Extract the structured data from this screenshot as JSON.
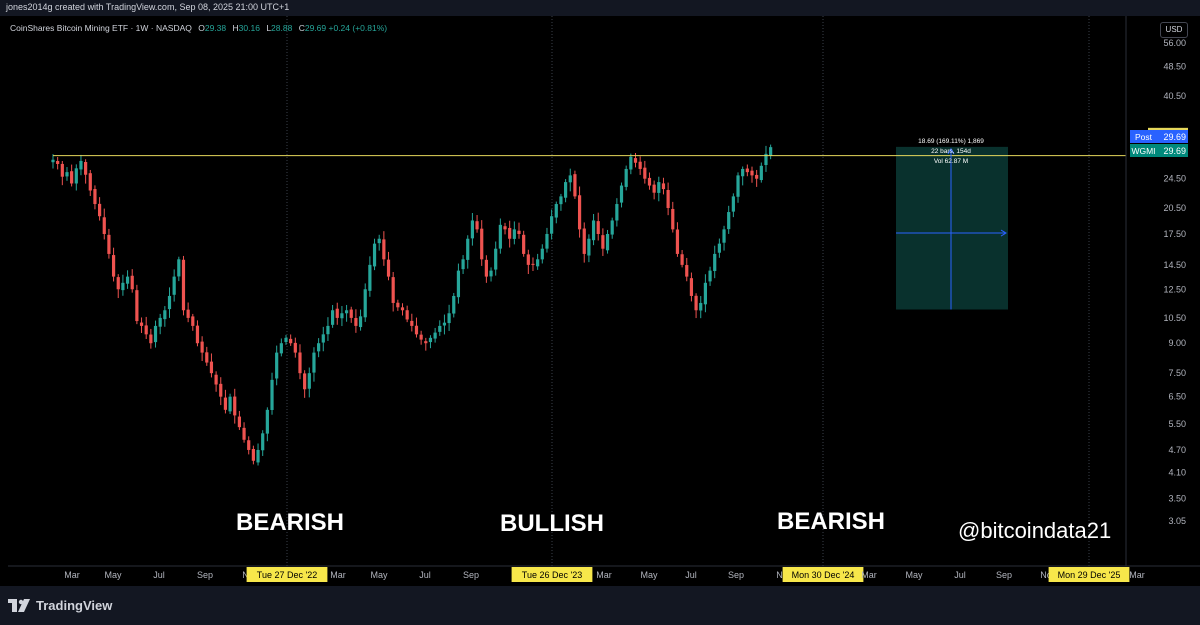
{
  "header": {
    "created_by": "jones2014g created with TradingView.com, Sep 08, 2025 21:00 UTC+1"
  },
  "legend": {
    "symbol": "CoinShares Bitcoin Mining ETF · 1W · NASDAQ",
    "open_label": "O",
    "open": "29.38",
    "high_label": "H",
    "high": "30.16",
    "low_label": "L",
    "low": "28.88",
    "close_label": "C",
    "close": "29.69",
    "change": "+0.24 (+0.81%)"
  },
  "currency": "USD",
  "footer": {
    "brand": "TradingView"
  },
  "colors": {
    "up": "#26a69a",
    "down": "#ef5350",
    "level": "#e6d85c",
    "measure": "#2962ff",
    "measure_fill": "#0b3a35",
    "post": "#2962ff",
    "ticker": "#00897b",
    "date_tag": "#f7e74a"
  },
  "chart_data": {
    "type": "candlestick",
    "symbol": "WGMI",
    "interval": "1W",
    "y_scale": "log",
    "ylim": [
      2.7,
      57
    ],
    "y_ticks": [
      3.05,
      3.5,
      4.1,
      4.7,
      5.5,
      6.5,
      7.5,
      9.0,
      10.5,
      12.5,
      14.5,
      17.5,
      20.5,
      24.5,
      28.5,
      40.5,
      48.5,
      56.0
    ],
    "y_tick_labels": [
      "3.05",
      "3.50",
      "4.10",
      "4.70",
      "5.50",
      "6.50",
      "7.50",
      "9.00",
      "10.50",
      "12.50",
      "14.50",
      "17.50",
      "20.50",
      "24.50",
      "28.50",
      "40.50",
      "48.50",
      "56.00"
    ],
    "x_labels": [
      "Mar",
      "May",
      "Jul",
      "Sep",
      "Nov",
      "Tue 27 Dec '22",
      "Mar",
      "May",
      "Jul",
      "Sep",
      "Nov",
      "Tue 26 Dec '23",
      "Mar",
      "May",
      "Jul",
      "Sep",
      "Nov",
      "Mon 30 Dec '24",
      "Mar",
      "May",
      "Jul",
      "Sep",
      "Nov",
      "Mon 29 Dec '25",
      "Mar"
    ],
    "x_label_display": [
      "Mar",
      "May",
      "Jul",
      "Sep",
      "No",
      "Tue 27 Dec '22",
      "Mar",
      "May",
      "Jul",
      "Sep",
      "No",
      "Tue 26 Dec '23",
      "Mar",
      "May",
      "Jul",
      "Sep",
      "No",
      "Mon 30 Dec '24",
      "Mar",
      "May",
      "Jul",
      "Sep",
      "No",
      "Mon 29 Dec '25",
      "Mar"
    ],
    "year_boundaries": [
      "Tue 27 Dec '22",
      "Tue 26 Dec '23",
      "Mon 30 Dec '24",
      "Mon 29 Dec '25"
    ],
    "weekly_closes": [
      27.5,
      26.8,
      24.8,
      25.5,
      23.8,
      26.1,
      27.3,
      25.1,
      22.8,
      21.0,
      19.5,
      17.5,
      15.5,
      13.5,
      12.5,
      13.0,
      13.5,
      12.5,
      10.3,
      10.0,
      9.5,
      9.0,
      10.0,
      10.5,
      11.0,
      12.0,
      13.5,
      15.0,
      11.0,
      10.5,
      10.0,
      9.0,
      8.5,
      8.0,
      7.5,
      7.0,
      6.5,
      6.0,
      6.5,
      5.8,
      5.4,
      5.0,
      4.7,
      4.4,
      4.7,
      5.2,
      6.0,
      7.2,
      8.5,
      9.0,
      9.3,
      9.0,
      8.5,
      7.5,
      6.8,
      7.5,
      8.5,
      9.0,
      9.5,
      10.0,
      11.0,
      10.5,
      10.8,
      11.0,
      10.5,
      10.0,
      10.6,
      12.5,
      14.5,
      16.5,
      17.0,
      15.0,
      13.5,
      11.5,
      11.2,
      11.0,
      10.4,
      10.0,
      9.5,
      9.2,
      9.0,
      9.3,
      9.6,
      10.0,
      10.2,
      10.8,
      12.0,
      14.0,
      15.0,
      17.0,
      19.0,
      18.0,
      15.0,
      13.5,
      14.0,
      16.0,
      18.5,
      18.0,
      17.0,
      18.0,
      17.5,
      15.5,
      14.5,
      14.5,
      15.0,
      16.0,
      17.5,
      19.5,
      21.0,
      22.0,
      24.0,
      25.0,
      22.0,
      18.0,
      15.5,
      17.0,
      19.0,
      17.5,
      16.0,
      17.5,
      19.0,
      21.0,
      23.5,
      26.0,
      28.0,
      27.0,
      26.0,
      24.5,
      23.5,
      22.5,
      24.0,
      23.0,
      20.5,
      18.0,
      15.5,
      14.5,
      13.5,
      12.0,
      11.0,
      11.5,
      13.0,
      14.0,
      15.5,
      16.5,
      18.0,
      20.0,
      22.0,
      25.0,
      26.0,
      25.5,
      25.0,
      24.5,
      26.5,
      28.5,
      29.69
    ],
    "resistance_level": 30.68,
    "price_labels": [
      {
        "label": "Post",
        "value": "29.69"
      },
      {
        "label": "WGMI",
        "value": "29.69"
      }
    ],
    "measure": {
      "line1": "18.69 (169.11%) 1,869",
      "line2": "22 bars, 154d",
      "line3": "Vol 62.87 M",
      "from_price": 11.05,
      "to_price": 29.74
    },
    "annotations": [
      "BEARISH",
      "BULLISH",
      "BEARISH"
    ],
    "watermark": "@bitcoindata21"
  }
}
